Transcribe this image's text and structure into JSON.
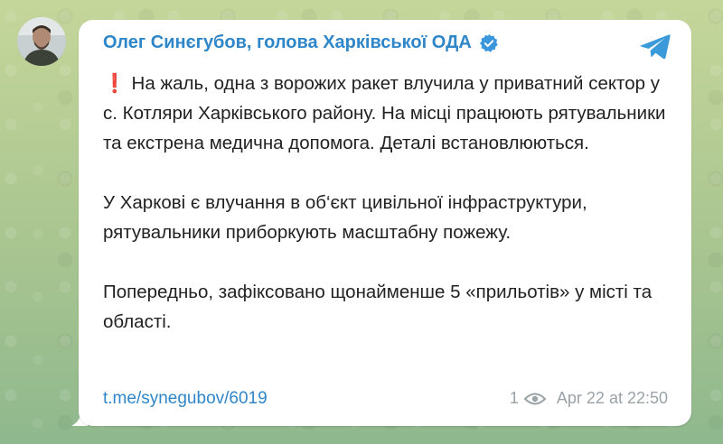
{
  "post": {
    "author": "Олег Синєгубов, голова Харківської ОДА",
    "paragraph_1": "На жаль, одна з ворожих ракет влучила у приватний сектор у с. Котляри Харківського району. На місці працюють рятувальники та екстрена медична допомога. Деталі встановлюються.",
    "paragraph_2": "У Харкові є влучання в об‘єкт цивільної інфраструктури, рятувальники приборкують масштабну пожежу.",
    "paragraph_3": "Попередньо, зафіксовано щонайменше 5 «прильотів» у місті та області.",
    "exclamation": "❗",
    "link": "t.me/synegubov/6019",
    "views": "1",
    "timestamp": "Apr 22 at 22:50"
  },
  "icons": {
    "verified": "verified-badge-icon",
    "share": "telegram-share-icon",
    "views": "eye-icon",
    "alert": "red-exclamation-icon"
  },
  "colors": {
    "author": "#2f86c8",
    "link": "#2f86c8",
    "alert": "#e0242b",
    "meta": "#9aa3a8",
    "background": "#b9cf9a"
  }
}
